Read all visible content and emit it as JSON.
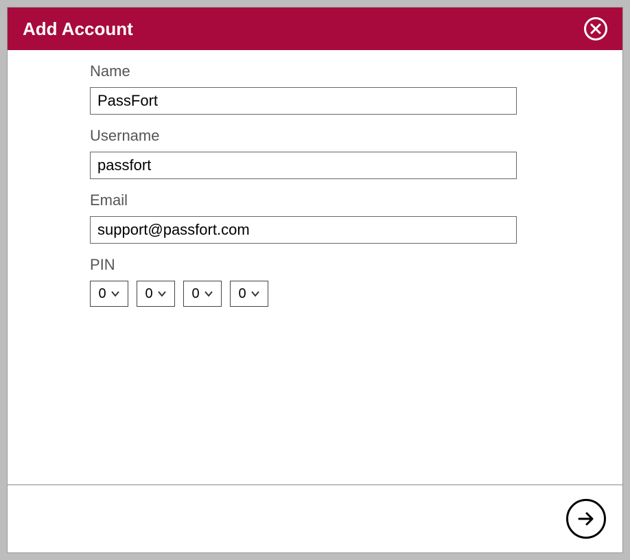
{
  "dialog": {
    "title": "Add Account"
  },
  "fields": {
    "name": {
      "label": "Name",
      "value": "PassFort"
    },
    "username": {
      "label": "Username",
      "value": "passfort"
    },
    "email": {
      "label": "Email",
      "value": "support@passfort.com"
    },
    "pin": {
      "label": "PIN",
      "digits": [
        "0",
        "0",
        "0",
        "0"
      ]
    }
  },
  "colors": {
    "header_bg": "#a80a3d",
    "header_fg": "#ffffff",
    "body_bg": "#ffffff",
    "label_fg": "#555555",
    "border": "#666666"
  }
}
